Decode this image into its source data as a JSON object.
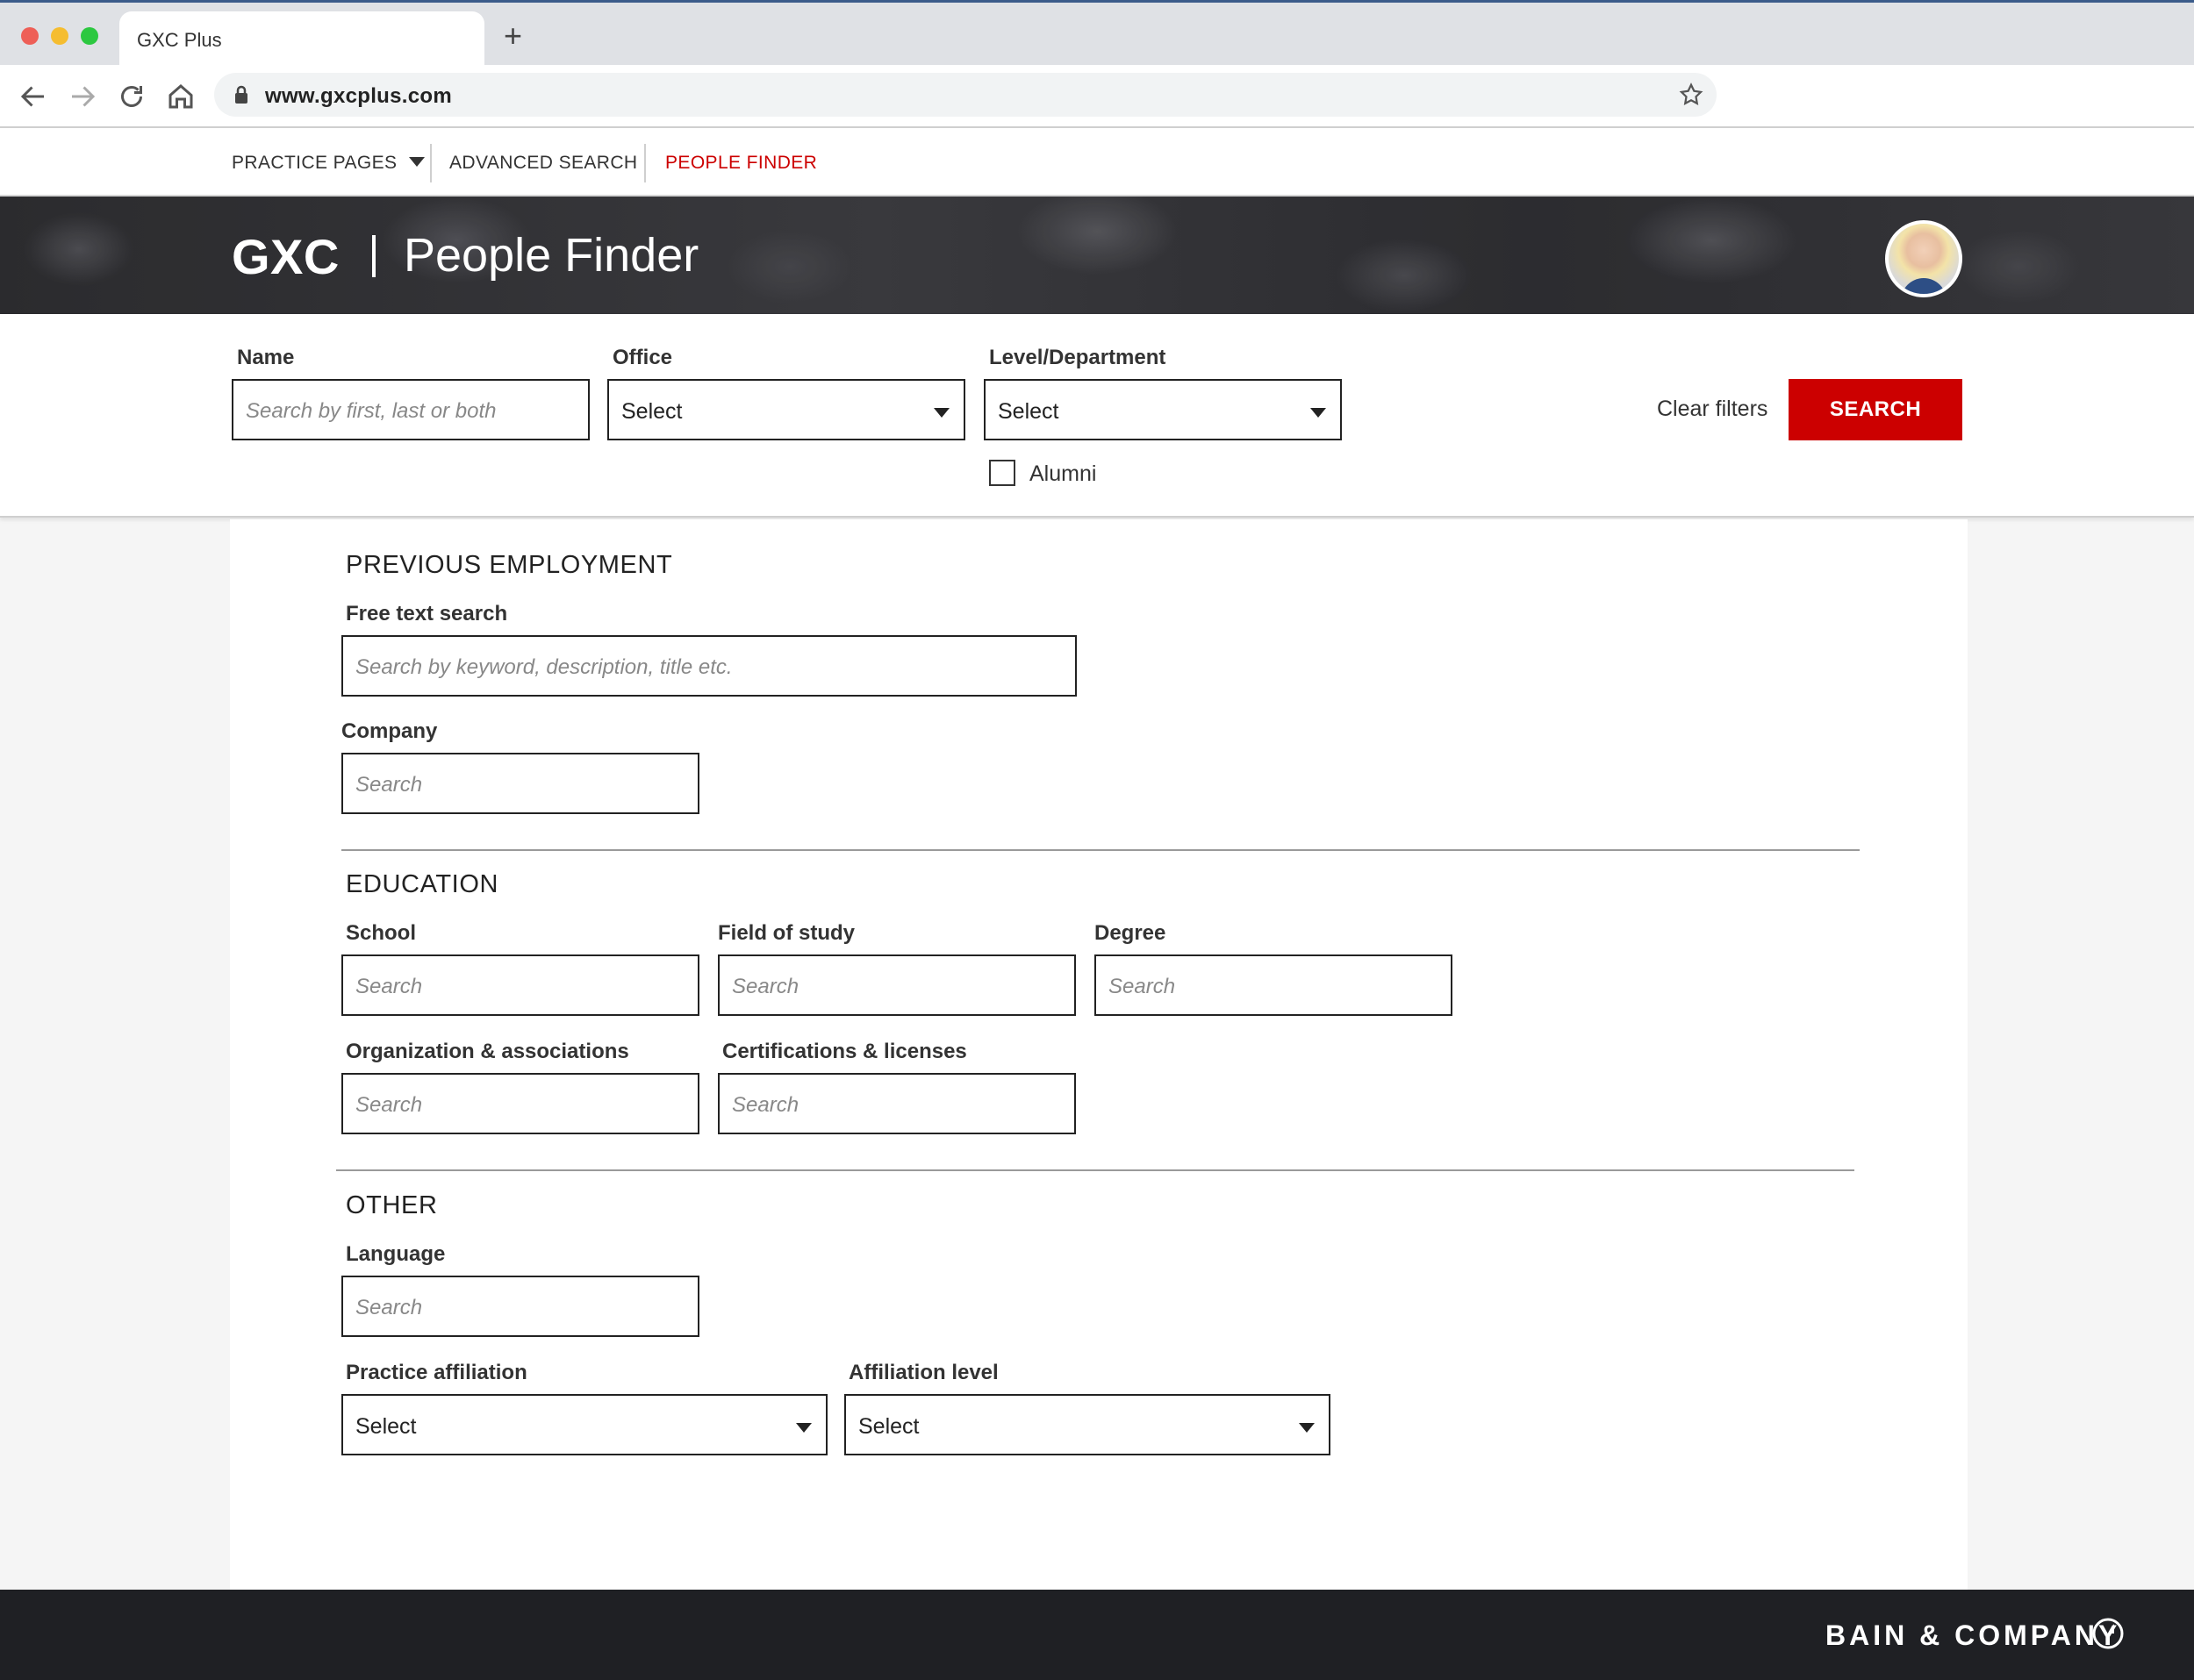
{
  "browser": {
    "tab_title": "GXC Plus",
    "url": "www.gxcplus.com"
  },
  "site_nav": {
    "items": [
      {
        "label": "PRACTICE PAGES",
        "has_dropdown": true,
        "color": "#333333"
      },
      {
        "label": "ADVANCED SEARCH",
        "color": "#333333"
      },
      {
        "label": "PEOPLE FINDER",
        "color": "#cc0000",
        "active": true
      }
    ]
  },
  "hero": {
    "brand": "GXC",
    "title": "People Finder"
  },
  "filters": {
    "name": {
      "label": "Name",
      "placeholder": "Search by first, last or both"
    },
    "office": {
      "label": "Office",
      "value": "Select"
    },
    "level": {
      "label": "Level/Department",
      "value": "Select"
    },
    "alumni": {
      "label": "Alumni",
      "checked": false
    },
    "clear_label": "Clear filters",
    "search_label": "SEARCH",
    "accent": "#cc0000"
  },
  "previous_employment": {
    "title": "PREVIOUS EMPLOYMENT",
    "free_text": {
      "label": "Free text search",
      "placeholder": "Search by keyword, description, title etc."
    },
    "company": {
      "label": "Company",
      "placeholder": "Search"
    }
  },
  "education": {
    "title": "EDUCATION",
    "school": {
      "label": "School",
      "placeholder": "Search"
    },
    "field_of_study": {
      "label": "Field of study",
      "placeholder": "Search"
    },
    "degree": {
      "label": "Degree",
      "placeholder": "Search"
    },
    "organizations": {
      "label": "Organization & associations",
      "placeholder": "Search"
    },
    "certifications": {
      "label": "Certifications & licenses",
      "placeholder": "Search"
    }
  },
  "other": {
    "title": "OTHER",
    "language": {
      "label": "Language",
      "placeholder": "Search"
    },
    "practice_affiliation": {
      "label": "Practice affiliation",
      "value": "Select"
    },
    "affiliation_level": {
      "label": "Affiliation level",
      "value": "Select"
    }
  },
  "footer": {
    "brand": "BAIN & COMPANY"
  }
}
